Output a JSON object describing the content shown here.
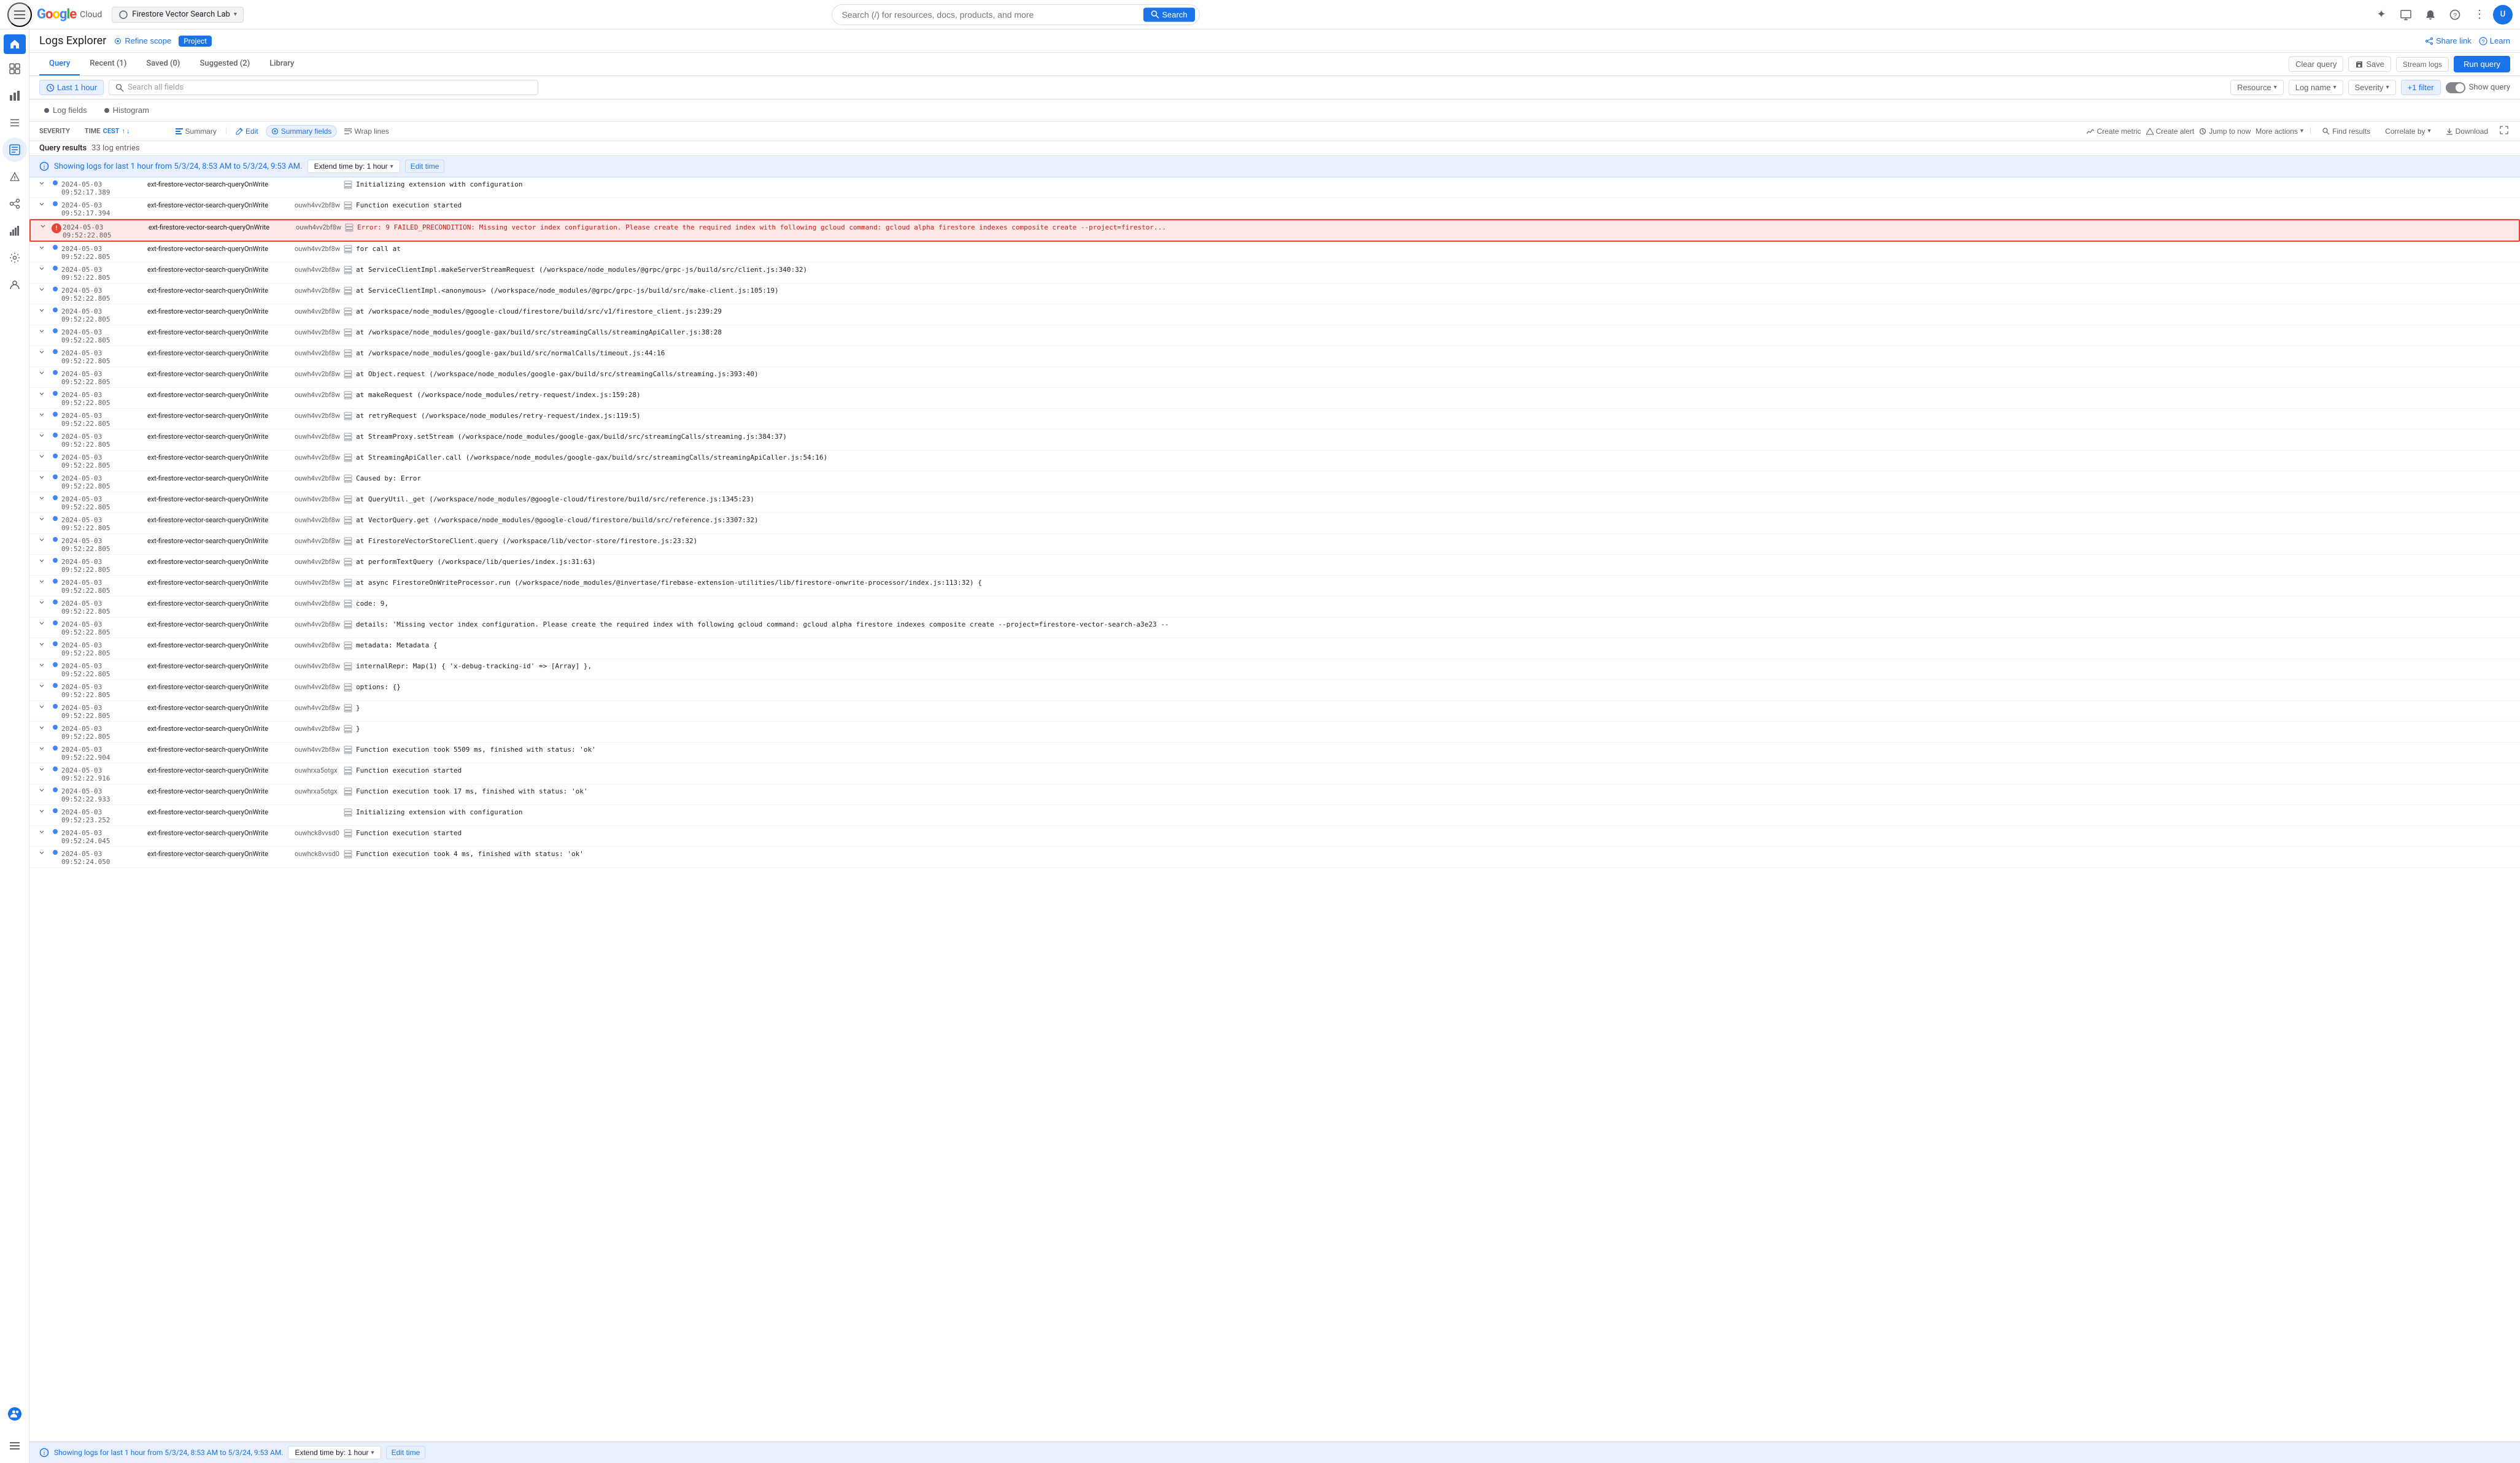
{
  "topNav": {
    "hamburger_label": "≡",
    "logo": {
      "g1": "G",
      "o1": "o",
      "o2": "o",
      "g2": "g",
      "l": "l",
      "e": "e",
      "cloud": " Cloud"
    },
    "project_selector": "Firestore Vector Search Lab",
    "search_placeholder": "Search (/) for resources, docs, products, and more",
    "search_btn": "Search",
    "icons": {
      "sparkle": "✦",
      "monitor": "⬜",
      "bell": "🔔",
      "help": "?",
      "dots": "⋮"
    },
    "avatar_text": "U"
  },
  "leftSidebar": {
    "icons": [
      "☰",
      "⊙",
      "▦",
      "📊",
      "📋",
      "🔔",
      "⊕",
      "✦",
      "⚙",
      "👤"
    ]
  },
  "pageHeader": {
    "title": "Logs Explorer",
    "refine_scope": "Refine scope",
    "project_badge": "Project",
    "share_link": "Share link",
    "learn": "Learn"
  },
  "tabs": [
    {
      "id": "query",
      "label": "Query",
      "active": true
    },
    {
      "id": "recent",
      "label": "Recent (1)",
      "active": false
    },
    {
      "id": "saved",
      "label": "Saved (0)",
      "active": false
    },
    {
      "id": "suggested",
      "label": "Suggested (2)",
      "active": false
    },
    {
      "id": "library",
      "label": "Library",
      "active": false
    }
  ],
  "tabActions": {
    "clear_query": "Clear query",
    "save": "Save",
    "stream_logs": "Stream logs",
    "run_query": "Run query"
  },
  "queryControls": {
    "time_range": "Last 1 hour",
    "search_placeholder": "Search all fields",
    "resource_label": "Resource",
    "log_name_label": "Log name",
    "severity_label": "Severity",
    "filter_label": "+1 filter",
    "show_query": "Show query"
  },
  "viewControls": {
    "log_fields": "Log fields",
    "histogram": "Histogram"
  },
  "logToolbar": {
    "severity_col": "Severity",
    "time_col": "Time",
    "time_sort": "CEST",
    "summary_label": "Summary",
    "edit_label": "Edit",
    "summary_fields": "Summary fields",
    "wrap_lines": "Wrap lines"
  },
  "resultsHeader": {
    "query_results": "Query results",
    "count": "33 log entries",
    "create_metric": "Create metric",
    "create_alert": "Create alert",
    "jump_to_now": "Jump to now",
    "more_actions": "More actions",
    "find_results": "Find results",
    "correlate_by": "Correlate by",
    "download": "Download",
    "expand_icon": "⤢"
  },
  "statusBar": {
    "message": "Showing logs for last 1 hour from 5/3/24, 8:53 AM to 5/3/24, 9:53 AM.",
    "extend_btn": "Extend time by: 1 hour",
    "edit_time": "Edit time"
  },
  "logEntries": [
    {
      "severity": "info",
      "time": "2024-05-03  09:52:17.389",
      "resource": "ext-firestore-vector-search-queryOnWrite",
      "instance": "",
      "message": "Initializing extension with configuration",
      "icon": "stack",
      "highlighted": false
    },
    {
      "severity": "info",
      "time": "2024-05-03  09:52:17.394",
      "resource": "ext-firestore-vector-search-queryOnWrite",
      "instance": "ouwh4vv2bf8w",
      "message": "Function execution started",
      "icon": "stack",
      "highlighted": false
    },
    {
      "severity": "error",
      "time": "2024-05-03  09:52:22.805",
      "resource": "ext-firestore-vector-search-queryOnWrite",
      "instance": "ouwh4vv2bf8w",
      "message": "Error: 9 FAILED_PRECONDITION: Missing vector index configuration. Please create the required index with following gcloud command: gcloud alpha firestore indexes composite create --project=firestor...",
      "icon": "stack",
      "highlighted": true
    },
    {
      "severity": "info",
      "time": "2024-05-03  09:52:22.805",
      "resource": "ext-firestore-vector-search-queryOnWrite",
      "instance": "ouwh4vv2bf8w",
      "message": "    for call at",
      "icon": "stack",
      "highlighted": false
    },
    {
      "severity": "info",
      "time": "2024-05-03  09:52:22.805",
      "resource": "ext-firestore-vector-search-queryOnWrite",
      "instance": "ouwh4vv2bf8w",
      "message": "    at ServiceClientImpl.makeServerStreamRequest (/workspace/node_modules/@grpc/grpc-js/build/src/client.js:340:32)",
      "icon": "stack",
      "highlighted": false
    },
    {
      "severity": "info",
      "time": "2024-05-03  09:52:22.805",
      "resource": "ext-firestore-vector-search-queryOnWrite",
      "instance": "ouwh4vv2bf8w",
      "message": "    at ServiceClientImpl.<anonymous> (/workspace/node_modules/@grpc/grpc-js/build/src/make-client.js:105:19)",
      "icon": "stack",
      "highlighted": false
    },
    {
      "severity": "info",
      "time": "2024-05-03  09:52:22.805",
      "resource": "ext-firestore-vector-search-queryOnWrite",
      "instance": "ouwh4vv2bf8w",
      "message": "    at /workspace/node_modules/@google-cloud/firestore/build/src/v1/firestore_client.js:239:29",
      "icon": "stack",
      "highlighted": false
    },
    {
      "severity": "info",
      "time": "2024-05-03  09:52:22.805",
      "resource": "ext-firestore-vector-search-queryOnWrite",
      "instance": "ouwh4vv2bf8w",
      "message": "    at /workspace/node_modules/google-gax/build/src/streamingCalls/streamingApiCaller.js:38:28",
      "icon": "stack",
      "highlighted": false
    },
    {
      "severity": "info",
      "time": "2024-05-03  09:52:22.805",
      "resource": "ext-firestore-vector-search-queryOnWrite",
      "instance": "ouwh4vv2bf8w",
      "message": "    at /workspace/node_modules/google-gax/build/src/normalCalls/timeout.js:44:16",
      "icon": "stack",
      "highlighted": false
    },
    {
      "severity": "info",
      "time": "2024-05-03  09:52:22.805",
      "resource": "ext-firestore-vector-search-queryOnWrite",
      "instance": "ouwh4vv2bf8w",
      "message": "    at Object.request (/workspace/node_modules/google-gax/build/src/streamingCalls/streaming.js:393:40)",
      "icon": "stack",
      "highlighted": false
    },
    {
      "severity": "info",
      "time": "2024-05-03  09:52:22.805",
      "resource": "ext-firestore-vector-search-queryOnWrite",
      "instance": "ouwh4vv2bf8w",
      "message": "    at makeRequest (/workspace/node_modules/retry-request/index.js:159:28)",
      "icon": "stack",
      "highlighted": false
    },
    {
      "severity": "info",
      "time": "2024-05-03  09:52:22.805",
      "resource": "ext-firestore-vector-search-queryOnWrite",
      "instance": "ouwh4vv2bf8w",
      "message": "    at retryRequest (/workspace/node_modules/retry-request/index.js:119:5)",
      "icon": "stack",
      "highlighted": false
    },
    {
      "severity": "info",
      "time": "2024-05-03  09:52:22.805",
      "resource": "ext-firestore-vector-search-queryOnWrite",
      "instance": "ouwh4vv2bf8w",
      "message": "    at StreamProxy.setStream (/workspace/node_modules/google-gax/build/src/streamingCalls/streaming.js:384:37)",
      "icon": "stack",
      "highlighted": false
    },
    {
      "severity": "info",
      "time": "2024-05-03  09:52:22.805",
      "resource": "ext-firestore-vector-search-queryOnWrite",
      "instance": "ouwh4vv2bf8w",
      "message": "    at StreamingApiCaller.call (/workspace/node_modules/google-gax/build/src/streamingCalls/streamingApiCaller.js:54:16)",
      "icon": "stack",
      "highlighted": false
    },
    {
      "severity": "info",
      "time": "2024-05-03  09:52:22.805",
      "resource": "ext-firestore-vector-search-queryOnWrite",
      "instance": "ouwh4vv2bf8w",
      "message": "Caused by: Error",
      "icon": "stack",
      "highlighted": false
    },
    {
      "severity": "info",
      "time": "2024-05-03  09:52:22.805",
      "resource": "ext-firestore-vector-search-queryOnWrite",
      "instance": "ouwh4vv2bf8w",
      "message": "    at QueryUtil._get (/workspace/node_modules/@google-cloud/firestore/build/src/reference.js:1345:23)",
      "icon": "stack",
      "highlighted": false
    },
    {
      "severity": "info",
      "time": "2024-05-03  09:52:22.805",
      "resource": "ext-firestore-vector-search-queryOnWrite",
      "instance": "ouwh4vv2bf8w",
      "message": "    at VectorQuery.get (/workspace/node_modules/@google-cloud/firestore/build/src/reference.js:3307:32)",
      "icon": "stack",
      "highlighted": false
    },
    {
      "severity": "info",
      "time": "2024-05-03  09:52:22.805",
      "resource": "ext-firestore-vector-search-queryOnWrite",
      "instance": "ouwh4vv2bf8w",
      "message": "    at FirestoreVectorStoreClient.query (/workspace/lib/vector-store/firestore.js:23:32)",
      "icon": "stack",
      "highlighted": false
    },
    {
      "severity": "info",
      "time": "2024-05-03  09:52:22.805",
      "resource": "ext-firestore-vector-search-queryOnWrite",
      "instance": "ouwh4vv2bf8w",
      "message": "    at performTextQuery (/workspace/lib/queries/index.js:31:63)",
      "icon": "stack",
      "highlighted": false
    },
    {
      "severity": "info",
      "time": "2024-05-03  09:52:22.805",
      "resource": "ext-firestore-vector-search-queryOnWrite",
      "instance": "ouwh4vv2bf8w",
      "message": "    at async FirestoreOnWriteProcessor.run (/workspace/node_modules/@invertase/firebase-extension-utilities/lib/firestore-onwrite-processor/index.js:113:32) {",
      "icon": "stack",
      "highlighted": false
    },
    {
      "severity": "info",
      "time": "2024-05-03  09:52:22.805",
      "resource": "ext-firestore-vector-search-queryOnWrite",
      "instance": "ouwh4vv2bf8w",
      "message": "code: 9,",
      "icon": "stack",
      "highlighted": false
    },
    {
      "severity": "info",
      "time": "2024-05-03  09:52:22.805",
      "resource": "ext-firestore-vector-search-queryOnWrite",
      "instance": "ouwh4vv2bf8w",
      "message": "details: 'Missing vector index configuration. Please create the required index with following gcloud command: gcloud alpha firestore indexes composite create --project=firestore-vector-search-a3e23 --",
      "icon": "stack",
      "highlighted": false
    },
    {
      "severity": "info",
      "time": "2024-05-03  09:52:22.805",
      "resource": "ext-firestore-vector-search-queryOnWrite",
      "instance": "ouwh4vv2bf8w",
      "message": "metadata: Metadata {",
      "icon": "stack",
      "highlighted": false
    },
    {
      "severity": "info",
      "time": "2024-05-03  09:52:22.805",
      "resource": "ext-firestore-vector-search-queryOnWrite",
      "instance": "ouwh4vv2bf8w",
      "message": "    internalRepr: Map(1) { 'x-debug-tracking-id' => [Array] },",
      "icon": "stack",
      "highlighted": false
    },
    {
      "severity": "info",
      "time": "2024-05-03  09:52:22.805",
      "resource": "ext-firestore-vector-search-queryOnWrite",
      "instance": "ouwh4vv2bf8w",
      "message": "    options: {}",
      "icon": "stack",
      "highlighted": false
    },
    {
      "severity": "info",
      "time": "2024-05-03  09:52:22.805",
      "resource": "ext-firestore-vector-search-queryOnWrite",
      "instance": "ouwh4vv2bf8w",
      "message": "  }",
      "icon": "stack",
      "highlighted": false
    },
    {
      "severity": "info",
      "time": "2024-05-03  09:52:22.805",
      "resource": "ext-firestore-vector-search-queryOnWrite",
      "instance": "ouwh4vv2bf8w",
      "message": "}",
      "icon": "stack",
      "highlighted": false
    },
    {
      "severity": "info",
      "time": "2024-05-03  09:52:22.904",
      "resource": "ext-firestore-vector-search-queryOnWrite",
      "instance": "ouwh4vv2bf8w",
      "message": "Function execution took 5509 ms, finished with status: 'ok'",
      "icon": "stack",
      "highlighted": false
    },
    {
      "severity": "info",
      "time": "2024-05-03  09:52:22.916",
      "resource": "ext-firestore-vector-search-queryOnWrite",
      "instance": "ouwhrxa5otgx",
      "message": "Function execution started",
      "icon": "stack",
      "highlighted": false
    },
    {
      "severity": "info",
      "time": "2024-05-03  09:52:22.933",
      "resource": "ext-firestore-vector-search-queryOnWrite",
      "instance": "ouwhrxa5otgx",
      "message": "Function execution took 17 ms, finished with status: 'ok'",
      "icon": "stack",
      "highlighted": false
    },
    {
      "severity": "info",
      "time": "2024-05-03  09:52:23.252",
      "resource": "ext-firestore-vector-search-queryOnWrite",
      "instance": "",
      "message": "Initializing extension with configuration",
      "icon": "stack",
      "highlighted": false
    },
    {
      "severity": "info",
      "time": "2024-05-03  09:52:24.045",
      "resource": "ext-firestore-vector-search-queryOnWrite",
      "instance": "ouwhck8vvsd0",
      "message": "Function execution started",
      "icon": "stack",
      "highlighted": false
    },
    {
      "severity": "info",
      "time": "2024-05-03  09:52:24.050",
      "resource": "ext-firestore-vector-search-queryOnWrite",
      "instance": "ouwhck8vvsd0",
      "message": "Function execution took 4 ms, finished with status: 'ok'",
      "icon": "stack",
      "highlighted": false
    }
  ],
  "bottomStatus": {
    "message": "Showing logs for last 1 hour from 5/3/24, 8:53 AM to 5/3/24, 9:53 AM.",
    "extend_btn": "Extend time by: 1 hour",
    "edit_time": "Edit time"
  }
}
